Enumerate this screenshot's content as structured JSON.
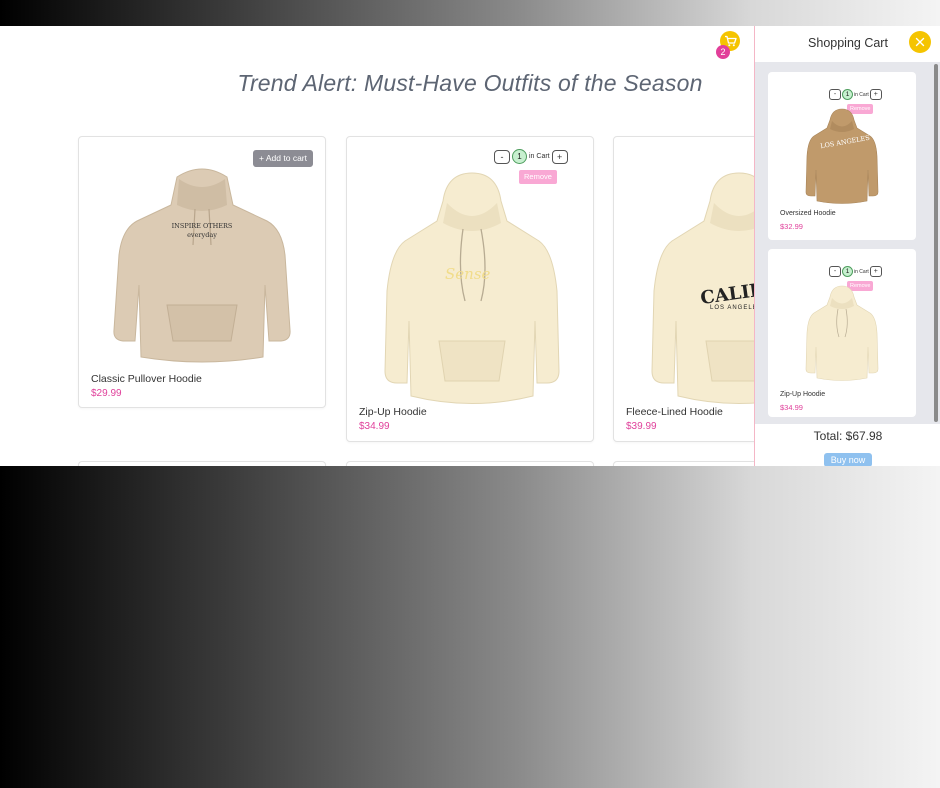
{
  "page": {
    "title": "Trend Alert: Must-Have Outfits of the Season"
  },
  "header": {
    "cart_count": "2"
  },
  "products": [
    {
      "name": "Classic Pullover Hoodie",
      "price": "$29.99",
      "add_label": "+ Add to cart",
      "print": "INSPIRE OTHERS everyday"
    },
    {
      "name": "Zip-Up Hoodie",
      "price": "$34.99",
      "qty": "1",
      "in_cart_label": "in Cart",
      "minus": "-",
      "plus": "+",
      "remove_label": "Remove",
      "print": "Sense"
    },
    {
      "name": "Fleece-Lined Hoodie",
      "price": "$39.99",
      "print": "CALIFORNIA",
      "print_sub": "LOS ANGELES"
    }
  ],
  "cart": {
    "title": "Shopping Cart",
    "items": [
      {
        "name": "Oversized Hoodie",
        "price": "$32.99",
        "qty": "1",
        "in_cart_label": "in Cart",
        "minus": "-",
        "plus": "+",
        "remove_label": "Remove",
        "print": "LOS ANGELES"
      },
      {
        "name": "Zip-Up Hoodie",
        "price": "$34.99",
        "qty": "1",
        "in_cart_label": "in Cart",
        "minus": "-",
        "plus": "+",
        "remove_label": "Remove"
      }
    ],
    "total_label": "Total: $67.98",
    "buy_label": "Buy now"
  },
  "colors": {
    "accent_yellow": "#f5c400",
    "price_pink": "#e0419b",
    "badge_pink": "#e23f9a",
    "remove_pink": "#f9a8d4",
    "buy_blue": "#8fc1ef",
    "hoodie_beige": "#dccbb4",
    "hoodie_cream": "#f6ecd0",
    "hoodie_tan": "#c09a6b"
  },
  "icons": {
    "cart": "cart-icon",
    "close": "close-icon"
  }
}
